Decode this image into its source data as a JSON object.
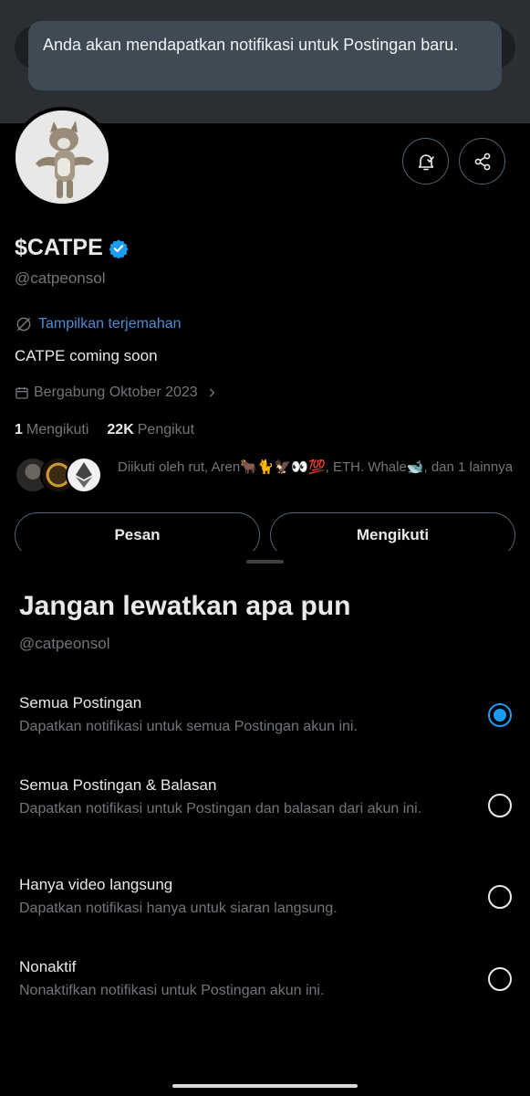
{
  "toast": {
    "message": "Anda akan mendapatkan notifikasi untuk Postingan baru."
  },
  "profile": {
    "display_name": "$CATPE",
    "handle": "@catpeonsol",
    "translate_link": "Tampilkan terjemahan",
    "bio": "CATPE coming soon",
    "joined": "Bergabung Oktober 2023",
    "following_count": "1",
    "following_label": "Mengikuti",
    "followers_count": "22K",
    "followers_label": "Pengikut",
    "followed_by": "Diikuti oleh rut, Aren🐂🐈🦅👀💯, ETH. Whale🐋, dan 1 lainnya",
    "verified_color": "#1d9bf0"
  },
  "actions": {
    "message_label": "Pesan",
    "following_label": "Mengikuti"
  },
  "icons": {
    "bell": "bell-check-icon",
    "share": "share-icon",
    "translate": "translate-icon",
    "calendar": "calendar-icon"
  },
  "sheet": {
    "title": "Jangan lewatkan apa pun",
    "handle": "@catpeonsol",
    "options": [
      {
        "title": "Semua Postingan",
        "desc": "Dapatkan notifikasi untuk semua Postingan akun ini.",
        "selected": true
      },
      {
        "title": "Semua Postingan & Balasan",
        "desc": "Dapatkan notifikasi untuk Postingan dan balasan dari akun ini.",
        "selected": false
      },
      {
        "title": "Hanya video langsung",
        "desc": "Dapatkan notifikasi hanya untuk siaran langsung.",
        "selected": false
      },
      {
        "title": "Nonaktif",
        "desc": "Nonaktifkan notifikasi untuk Postingan akun ini.",
        "selected": false
      }
    ]
  }
}
